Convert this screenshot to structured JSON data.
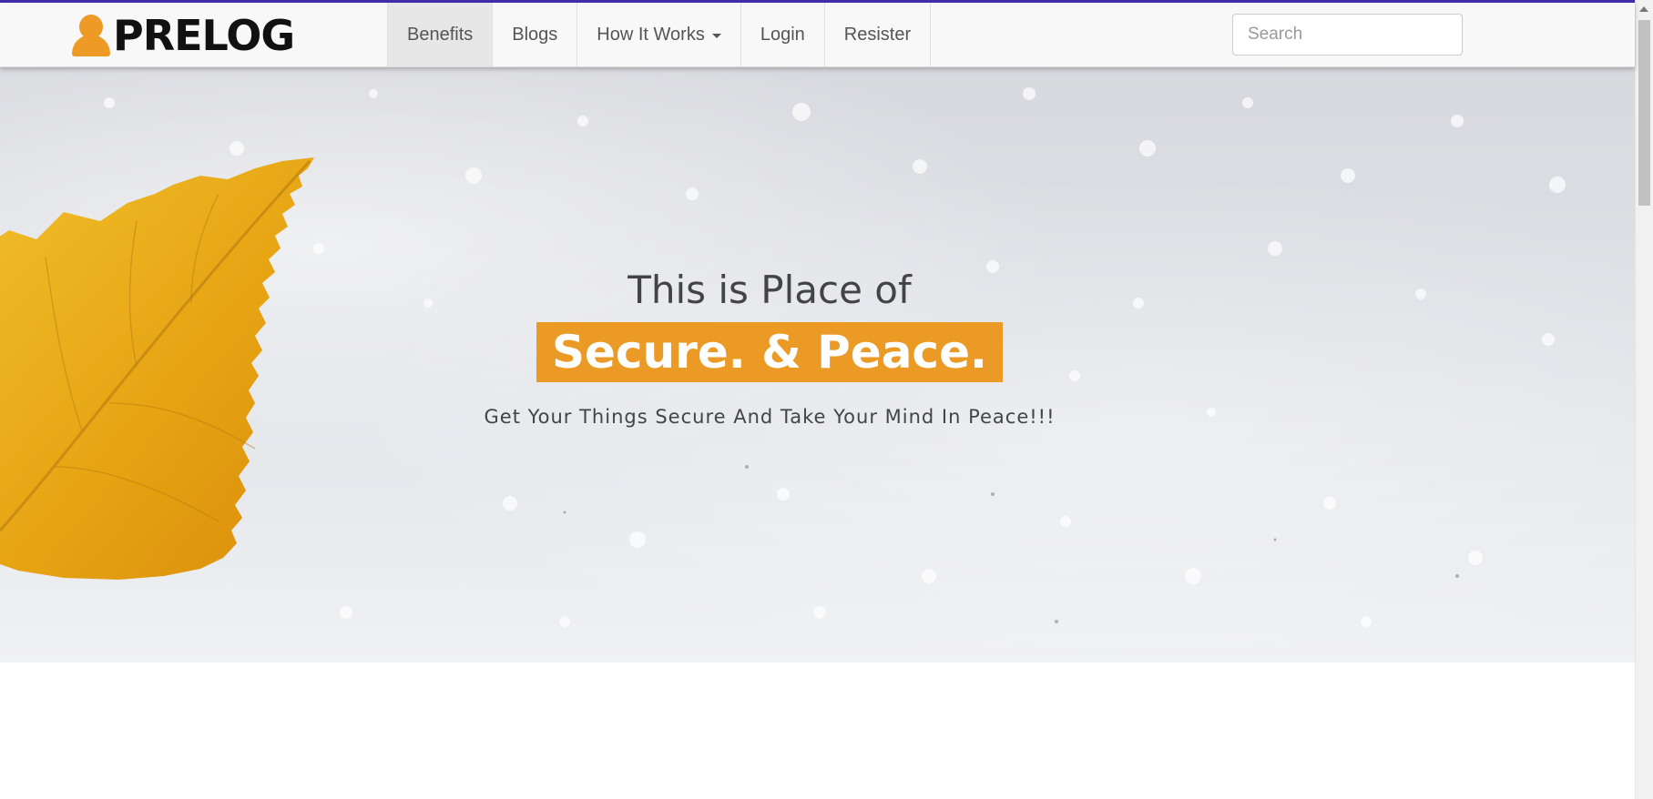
{
  "brand": {
    "name": "PRELOG",
    "icon": "person-icon"
  },
  "nav": {
    "items": [
      {
        "label": "Benefits",
        "active": true
      },
      {
        "label": "Blogs"
      },
      {
        "label": "How It Works",
        "dropdown": true
      },
      {
        "label": "Login"
      },
      {
        "label": "Resister"
      }
    ]
  },
  "search": {
    "placeholder": "Search",
    "value": ""
  },
  "hero": {
    "tagline": "This is Place of",
    "headline": "Secure. & Peace.",
    "subline": "Get Your Things Secure And Take Your Mind In Peace!!!"
  },
  "colors": {
    "accent": "#ec9a26",
    "top_line": "#3f2fb0",
    "nav_background": "#f8f8f8",
    "active_nav_background": "#e7e7e7"
  }
}
